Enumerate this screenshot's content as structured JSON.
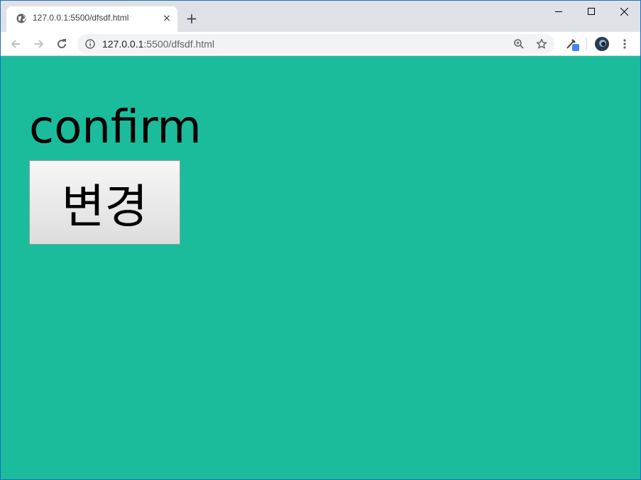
{
  "browser": {
    "tab": {
      "title": "127.0.0.1:5500/dfsdf.html",
      "favicon": "globe-icon",
      "close": "×"
    },
    "new_tab": "+",
    "address": {
      "host": "127.0.0.1",
      "path": ":5500/dfsdf.html"
    }
  },
  "page": {
    "heading": "confirm",
    "button_label": "변경",
    "background_color": "#1abc9c"
  }
}
